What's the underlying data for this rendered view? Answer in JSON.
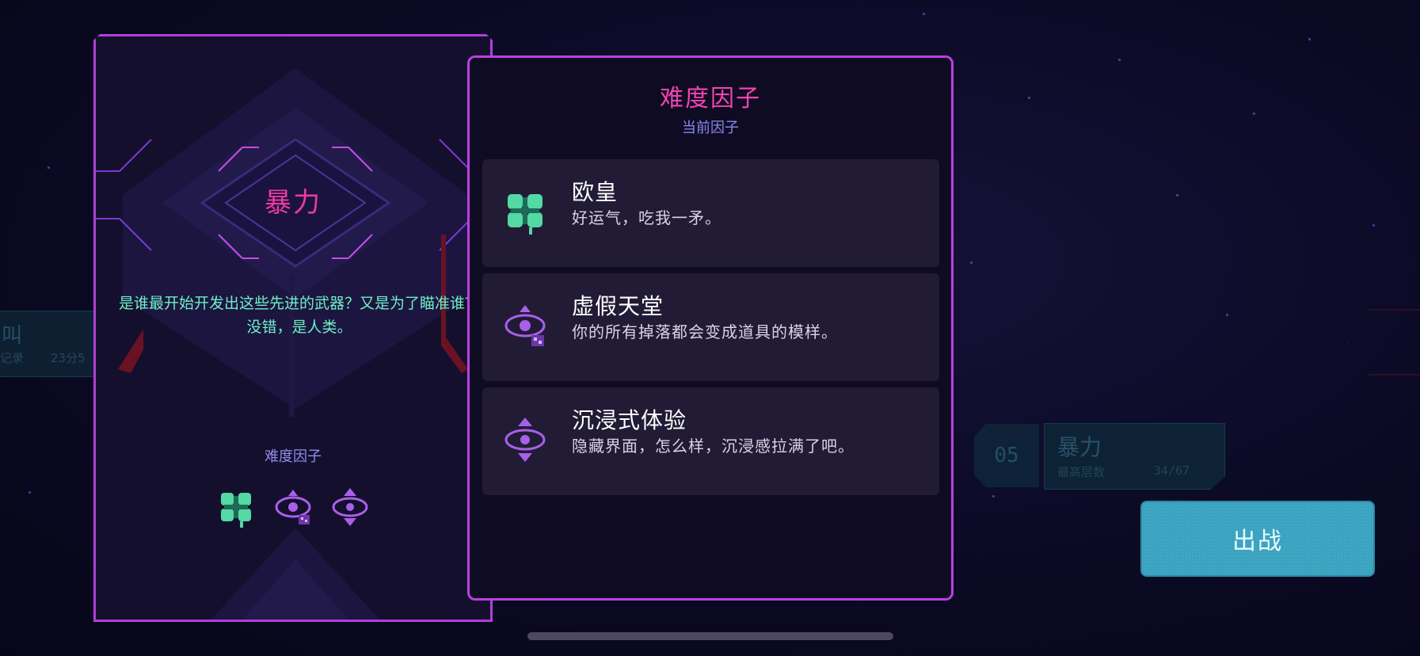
{
  "background": {
    "left_card": {
      "title": "叫",
      "label": "记录",
      "value": "23分5"
    },
    "right_card": {
      "level_number": "05",
      "title": "暴力",
      "label": "最高层数",
      "value": "34/67"
    }
  },
  "deploy_button": {
    "label": "出战"
  },
  "mode_panel": {
    "title": "暴力",
    "description": "是谁最开始开发出这些先进的武器？又是为了瞄准谁？没错，是人类。",
    "factor_label": "难度因子",
    "factor_icons": [
      "clover-icon",
      "eye-box-icon",
      "eye-diamond-icon"
    ]
  },
  "factors_panel": {
    "title": "难度因子",
    "subtitle": "当前因子",
    "factors": [
      {
        "name": "欧皇",
        "description": "好运气，吃我一矛。",
        "icon": "clover-icon",
        "color": "#54d8a4"
      },
      {
        "name": "虚假天堂",
        "description": "你的所有掉落都会变成道具的模样。",
        "icon": "eye-box-icon",
        "color": "#a860e8"
      },
      {
        "name": "沉浸式体验",
        "description": "隐藏界面，怎么样，沉浸感拉满了吧。",
        "icon": "eye-diamond-icon",
        "color": "#a860e8"
      }
    ]
  },
  "colors": {
    "panel_border": "#b941e0",
    "accent_pink": "#f044b0",
    "accent_green": "#6ef0c6",
    "accent_blue": "#3aa3c0"
  }
}
